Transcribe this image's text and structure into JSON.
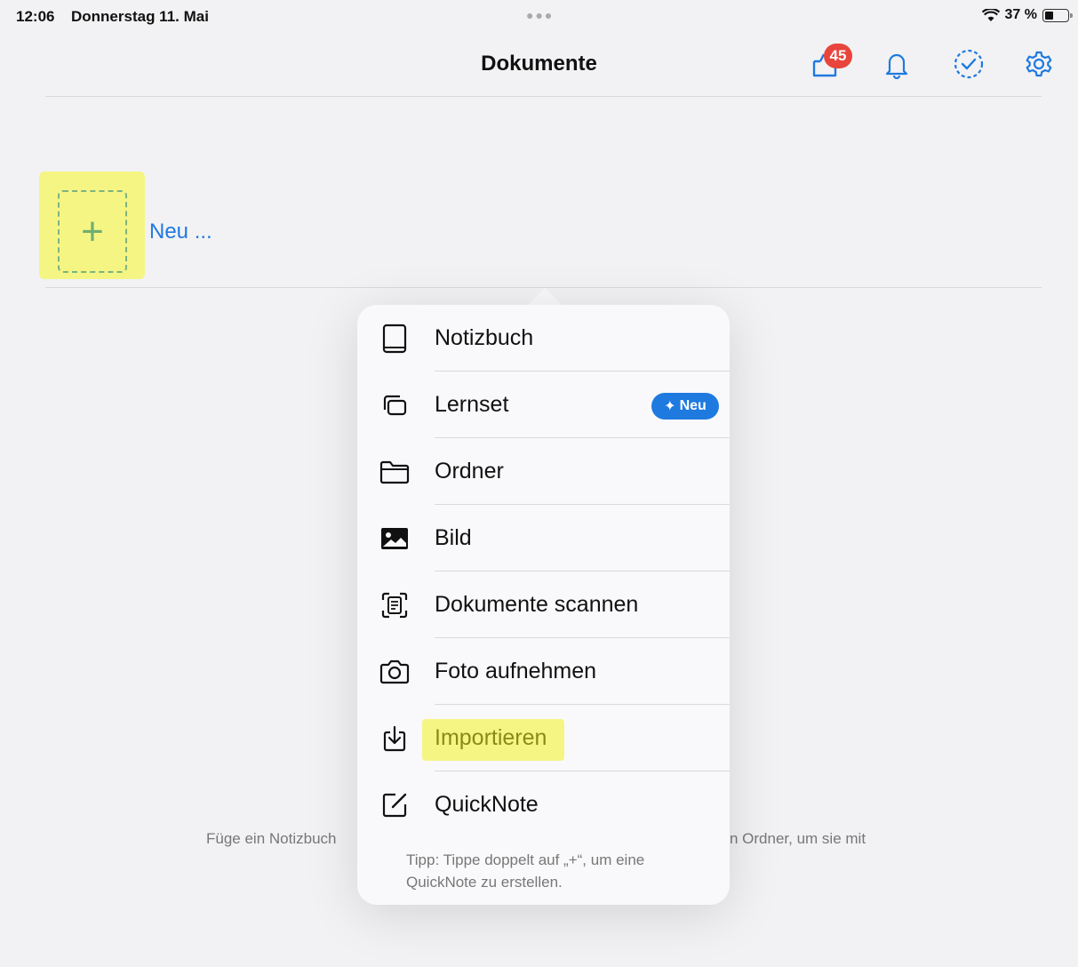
{
  "statusbar": {
    "time": "12:06",
    "date": "Donnerstag 11. Mai",
    "battery_text": "37 %",
    "battery_level": 0.37
  },
  "nav": {
    "title": "Dokumente",
    "inbox_badge": "45",
    "icons": [
      "inbox-icon",
      "bell-icon",
      "dashed-check-icon",
      "gear-icon"
    ],
    "accent_color": "#1f7ae0"
  },
  "new_tile": {
    "label": "Neu ..."
  },
  "empty_state": {
    "left_text": "Füge ein Notizbuch",
    "right_text": "n Ordner, um sie mit"
  },
  "menu": {
    "items": [
      {
        "label": "Notizbuch",
        "icon": "notebook-icon"
      },
      {
        "label": "Lernset",
        "icon": "cards-icon",
        "badge": "Neu"
      },
      {
        "label": "Ordner",
        "icon": "folder-icon"
      },
      {
        "label": "Bild",
        "icon": "image-icon"
      },
      {
        "label": "Dokumente scannen",
        "icon": "scan-icon"
      },
      {
        "label": "Foto aufnehmen",
        "icon": "camera-icon"
      },
      {
        "label": "Importieren",
        "icon": "import-icon"
      },
      {
        "label": "QuickNote",
        "icon": "quicknote-icon"
      }
    ],
    "tip": "Tipp: Tippe doppelt auf „+“, um eine QuickNote zu erstellen."
  }
}
